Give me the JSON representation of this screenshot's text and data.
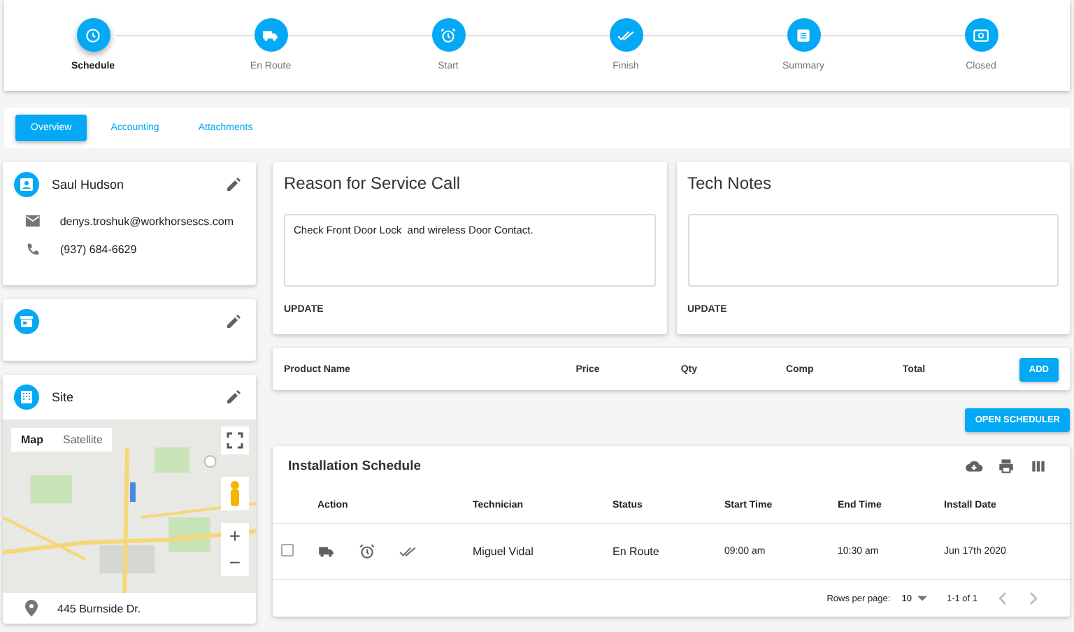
{
  "steps": [
    {
      "label": "Schedule",
      "kind": "clock",
      "selected": true
    },
    {
      "label": "En Route",
      "kind": "truck",
      "selected": false
    },
    {
      "label": "Start",
      "kind": "alarm",
      "selected": false
    },
    {
      "label": "Finish",
      "kind": "check",
      "selected": false
    },
    {
      "label": "Summary",
      "kind": "doc",
      "selected": false
    },
    {
      "label": "Closed",
      "kind": "money",
      "selected": false
    }
  ],
  "tabs": [
    {
      "label": "Overview",
      "selected": true
    },
    {
      "label": "Accounting",
      "selected": false
    },
    {
      "label": "Attachments",
      "selected": false
    }
  ],
  "contact": {
    "name": "Saul Hudson",
    "email": "denys.troshuk@workhorsescs.com",
    "phone": "(937) 684-6629"
  },
  "site": {
    "title": "Site",
    "map": {
      "kind": "picture",
      "buttons": [
        {
          "label": "Map",
          "selected": true
        },
        {
          "label": "Satellite",
          "selected": false
        }
      ],
      "zoom_in": "+",
      "zoom_out": "−"
    },
    "address": "445 Burnside Dr."
  },
  "reason": {
    "title": "Reason for Service Call",
    "value": "Check Front Door Lock  and wireless Door Contact.",
    "button": "UPDATE"
  },
  "notes": {
    "title": "Tech Notes",
    "button": "UPDATE"
  },
  "products": {
    "columns": [
      "Product Name",
      "Price",
      "Qty",
      "Comp",
      "Total"
    ],
    "button": "ADD"
  },
  "open_scheduler": "OPEN SCHEDULER",
  "schedule": {
    "title": "Installation Schedule",
    "columns": [
      "Action",
      "Technician",
      "Status",
      "Start Time",
      "End Time",
      "Install Date"
    ],
    "rows": [
      {
        "checked": false,
        "technician": "Miguel Vidal",
        "status": "En Route",
        "start": "09:00 am",
        "end": "10:30 am",
        "date": "Jun 17th 2020"
      }
    ],
    "rows_per_page_label": "Rows per page:",
    "rows_per_page": "10",
    "range": "1-1 of 1"
  }
}
